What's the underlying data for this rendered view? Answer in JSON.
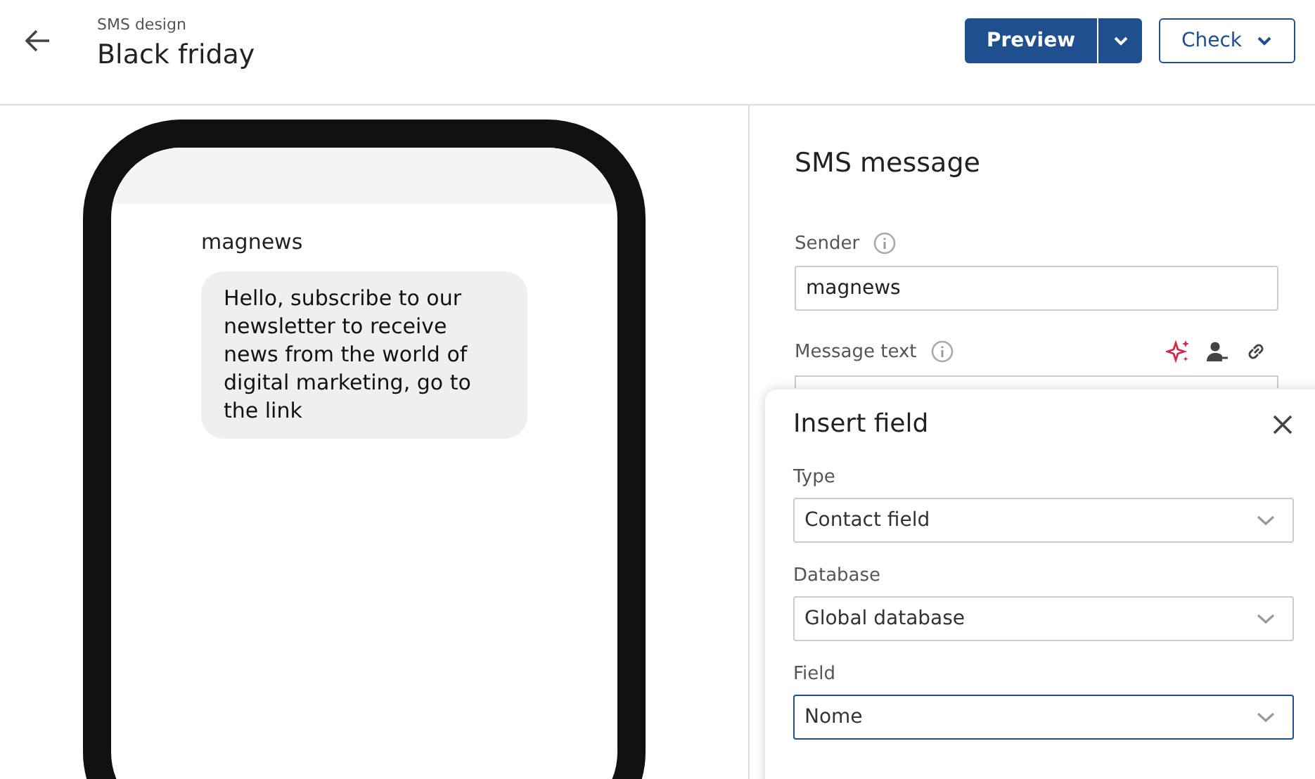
{
  "header": {
    "breadcrumb": "SMS design",
    "title": "Black friday",
    "preview_button": "Preview",
    "check_button": "Check"
  },
  "phone": {
    "sender": "magnews",
    "message": "Hello, subscribe to our newsletter to receive news from the world of digital marketing, go to the link"
  },
  "form": {
    "title": "SMS message",
    "sender_label": "Sender",
    "sender_value": "magnews",
    "message_label": "Message text"
  },
  "insert_field": {
    "title": "Insert field",
    "fields": [
      {
        "label": "Type",
        "value": "Contact field",
        "focused": false
      },
      {
        "label": "Database",
        "value": "Global database",
        "focused": false
      },
      {
        "label": "Field",
        "value": "Nome",
        "focused": true
      }
    ]
  }
}
